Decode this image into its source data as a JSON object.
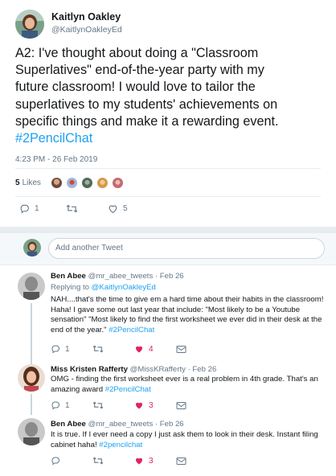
{
  "main_tweet": {
    "author_name": "Kaitlyn Oakley",
    "author_handle": "@KaitlynOakleyEd",
    "text_line1": "A2: I've thought about doing a \"Classroom",
    "text_line2": "Superlatives\" end-of-the-year party with my",
    "text_line3": "future classroom! I would love to tailor the",
    "text_line4": "superlatives to my students' achievements on",
    "text_line5": "specific things and make it a rewarding event.",
    "hashtag": "#2PencilChat",
    "timestamp": "4:23 PM - 26 Feb 2019",
    "likes_count": "5",
    "likes_label": "Likes",
    "reply_count": "1",
    "like_count": "5",
    "icons": [
      "reply-icon",
      "retweet-icon",
      "heart-icon"
    ]
  },
  "reply_box": {
    "placeholder": "Add another Tweet"
  },
  "replies": [
    {
      "name": "Ben Abee",
      "meta": "@mr_abee_tweets · Feb 26",
      "replying_to_label": "Replying to",
      "replying_to_handle": "@KaitlynOakleyEd",
      "line1": "NAH....that's the time to give em a hard time about their habits in the classroom!",
      "line2": "Haha! I gave some out last year that include: \"Most likely to be a Youtube",
      "line3": "sensation\" \"Most likely to find the first worksheet we ever did in their desk at the",
      "line4": "end of the year.\"",
      "hashtag": "#2PencilChat",
      "reply_count": "1",
      "like_count": "4"
    },
    {
      "name": "Miss Kristen Rafferty",
      "meta": "@MissKRafferty · Feb 26",
      "line1": "OMG - finding the first worksheet ever is a real problem in 4th grade. That's an",
      "line2": "amazing award",
      "hashtag": "#2PencilChat",
      "reply_count": "1",
      "like_count": "3"
    },
    {
      "name": "Ben Abee",
      "meta": "@mr_abee_tweets · Feb 26",
      "line1": "It is true. If I ever need a copy I just ask them to look in their desk. Instant filing",
      "line2": "cabinet haha!",
      "hashtag": "#2pencilchat",
      "like_count": "3"
    }
  ],
  "colors": {
    "link": "#1da1f2",
    "liked": "#e0245e",
    "muted": "#657786"
  }
}
